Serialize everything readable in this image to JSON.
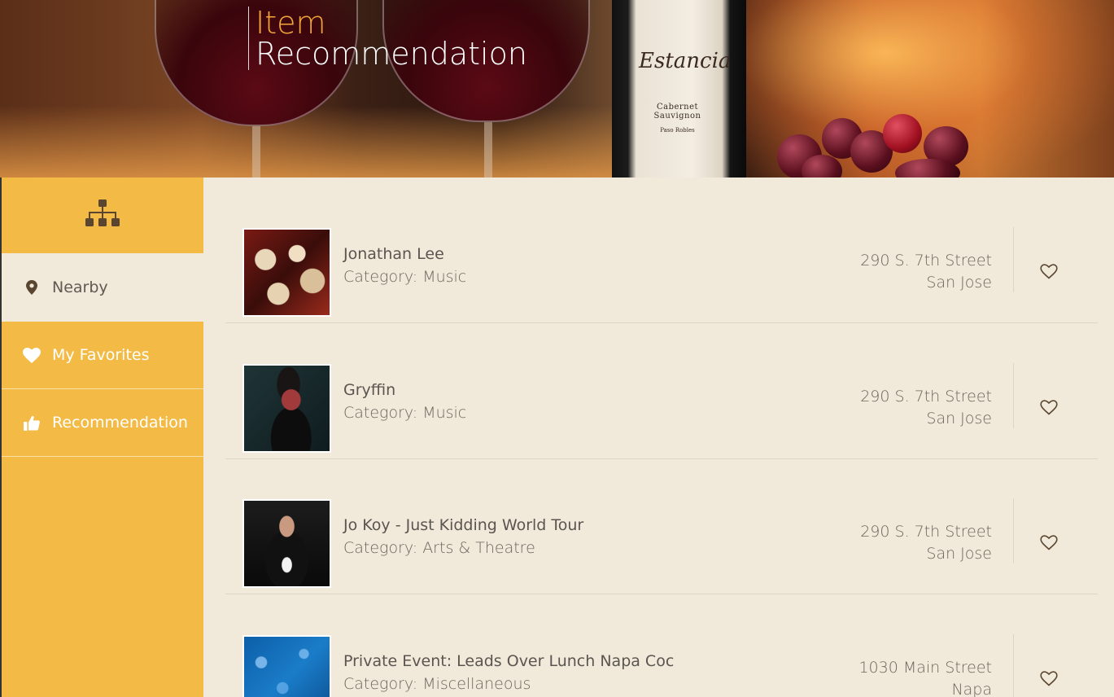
{
  "header": {
    "title_line1": "Item",
    "title_line2": "Recommendation",
    "bottle_brand": "Estancia",
    "bottle_varietal": "Cabernet Sauvignon",
    "bottle_region": "Paso Robles"
  },
  "sidebar": {
    "logo_icon": "sitemap-icon",
    "items": [
      {
        "label": "Nearby",
        "icon": "map-pin-icon",
        "active": true
      },
      {
        "label": "My Favorites",
        "icon": "heart-icon",
        "active": false
      },
      {
        "label": "Recommendation",
        "icon": "thumbs-up-icon",
        "active": false
      }
    ]
  },
  "colors": {
    "sidebar_bg": "#f3bb45",
    "content_bg": "#f1eada",
    "title_accent": "#f3a73a",
    "text": "#5a5550"
  },
  "items": [
    {
      "name": "Jonathan Lee",
      "category": "Category: Music",
      "address_line1": "290 S. 7th Street",
      "address_line2": "San Jose",
      "fav_icon": "heart-outline-icon"
    },
    {
      "name": "Gryffin",
      "category": "Category: Music",
      "address_line1": "290 S. 7th Street",
      "address_line2": "San Jose",
      "fav_icon": "heart-outline-icon"
    },
    {
      "name": "Jo Koy - Just Kidding World Tour",
      "category": "Category: Arts & Theatre",
      "address_line1": "290 S. 7th Street",
      "address_line2": "San Jose",
      "fav_icon": "heart-outline-icon"
    },
    {
      "name": "Private Event: Leads Over Lunch Napa Coc",
      "category": "Category: Miscellaneous",
      "address_line1": "1030 Main Street",
      "address_line2": "Napa",
      "fav_icon": "heart-outline-icon"
    }
  ]
}
